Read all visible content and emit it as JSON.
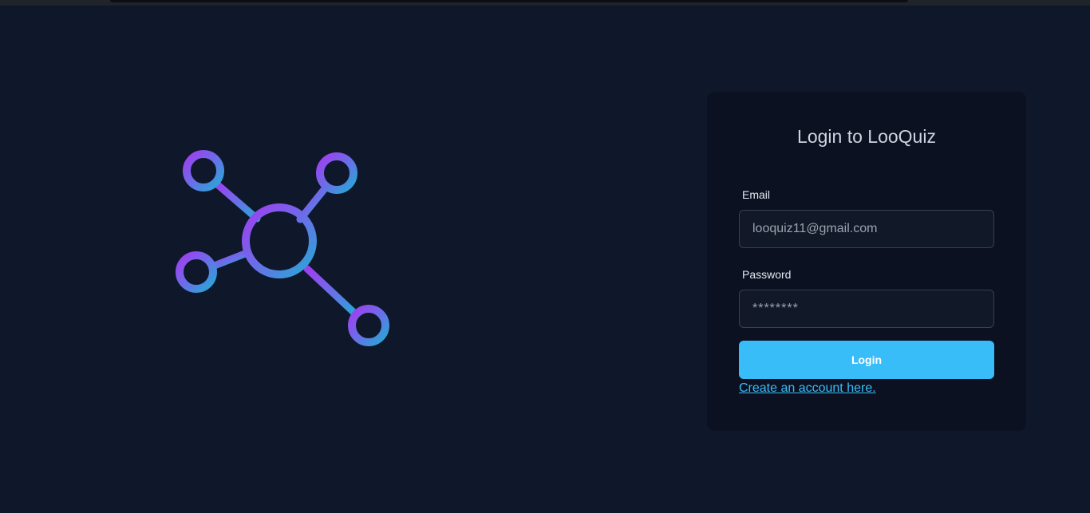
{
  "browser": {
    "top_strip_color": "#1f2429"
  },
  "logo": {
    "icon": "network-hub-icon",
    "gradient_start": "#a03df0",
    "gradient_end": "#25a9d6"
  },
  "login_form": {
    "title": "Login to LooQuiz",
    "email_label": "Email",
    "email_value": "looquiz11@gmail.com",
    "password_label": "Password",
    "password_value": "********",
    "login_button_label": "Login",
    "create_account_link": "Create an account here."
  },
  "colors": {
    "background": "#0f172a",
    "card": "#0b1120",
    "accent": "#38bdf8"
  }
}
